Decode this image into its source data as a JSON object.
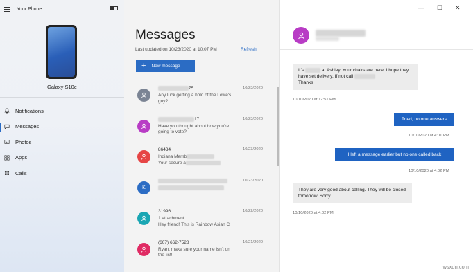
{
  "app": {
    "title": "Your Phone"
  },
  "sidebar": {
    "device_name": "Galaxy S10e",
    "items": [
      {
        "label": "Notifications",
        "icon": "bell-icon"
      },
      {
        "label": "Messages",
        "icon": "message-icon",
        "active": true
      },
      {
        "label": "Photos",
        "icon": "photo-icon"
      },
      {
        "label": "Apps",
        "icon": "apps-grid-icon"
      },
      {
        "label": "Calls",
        "icon": "dialpad-icon"
      }
    ]
  },
  "messages": {
    "title": "Messages",
    "last_updated": "Last updated on 10/23/2020 at 10:07 PM",
    "refresh": "Refresh",
    "new_message": "New message",
    "conversations": [
      {
        "name": "75",
        "preview": "Any luck getting a hold of the Lowe's guy?",
        "date": "10/23/2020",
        "color": "#7b8494",
        "initial": ""
      },
      {
        "name": "17",
        "preview": "Have you thought about how you're going to vote?",
        "date": "10/23/2020",
        "color": "#b83cc5",
        "initial": ""
      },
      {
        "name": "86434",
        "preview": "Indiana Memb",
        "preview2": "Your secure a",
        "date": "10/23/2020",
        "color": "#e64545",
        "initial": ""
      },
      {
        "name": "",
        "preview": "",
        "date": "10/23/2020",
        "color": "#2b6cc4",
        "initial": "K"
      },
      {
        "name": "31996",
        "preview": "1 attachment.",
        "preview2": "Hey friend! This is Rainbow Asian C",
        "date": "10/22/2020",
        "color": "#1aa6b3",
        "initial": ""
      },
      {
        "name": "(607) 662-7528",
        "preview": "Ryan, make sure your name isn't on the list!",
        "date": "10/21/2020",
        "color": "#e02b64",
        "initial": ""
      }
    ]
  },
  "chat": {
    "messages": [
      {
        "dir": "in",
        "text_a": "It's",
        "text_b": "at Ashley. Your chairs are here. I hope they have set delivery.  If not call",
        "text_c": "Thanks",
        "time": "10/10/2020 at 12:51 PM"
      },
      {
        "dir": "out",
        "text": "Tried, no one answers",
        "time": "10/10/2020 at 4:01 PM"
      },
      {
        "dir": "out",
        "text": "I left a message earlier but no one called back",
        "time": "10/10/2020 at 4:02 PM"
      },
      {
        "dir": "in",
        "text": "They are very good about calling. They will be closed tomorrow. Sorry",
        "time": "10/10/2020 at 4:02 PM"
      }
    ]
  },
  "window_controls": {
    "minimize": "—",
    "maximize": "☐",
    "close": "✕"
  },
  "watermark": "wsxdn.com",
  "colors": {
    "accent": "#2b6cc4",
    "sent_bubble": "#1f63c2",
    "received_bubble": "#ececec"
  }
}
